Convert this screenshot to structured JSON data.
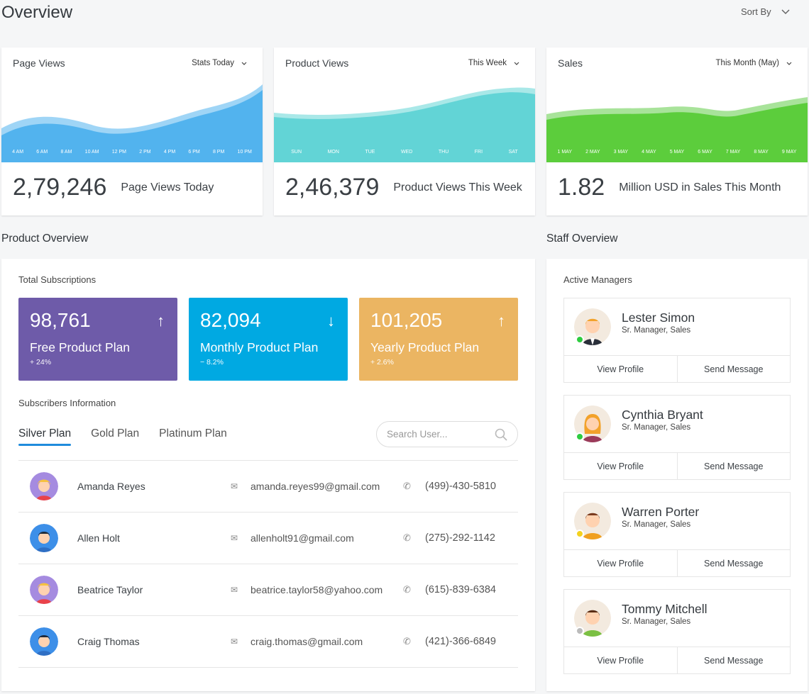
{
  "header": {
    "title": "Overview",
    "sort_label": "Sort By"
  },
  "stats": [
    {
      "title": "Page Views",
      "range": "Stats Today",
      "value": "2,79,246",
      "desc": "Page Views Today",
      "color": "#52b3ee",
      "ticks": [
        "4 AM",
        "6 AM",
        "8 AM",
        "10 AM",
        "12 PM",
        "2 PM",
        "4 PM",
        "6 PM",
        "8 PM",
        "10 PM"
      ]
    },
    {
      "title": "Product Views",
      "range": "This Week",
      "value": "2,46,379",
      "desc": "Product Views This Week",
      "color": "#62d4d6",
      "ticks": [
        "SUN",
        "MON",
        "TUE",
        "WED",
        "THU",
        "FRI",
        "SAT"
      ]
    },
    {
      "title": "Sales",
      "range": "This Month (May)",
      "value": "1.82",
      "desc": "Million USD in Sales This Month",
      "color": "#5ccd3c",
      "ticks": [
        "1 MAY",
        "2 MAY",
        "3 MAY",
        "4 MAY",
        "5 MAY",
        "6 MAY",
        "7 MAY",
        "8 MAY",
        "9 MAY"
      ]
    }
  ],
  "product": {
    "section_title": "Product Overview",
    "subscriptions_label": "Total Subscriptions",
    "plans": [
      {
        "value": "98,761",
        "name": "Free Product Plan",
        "pct": "+ 24%",
        "arrow": "↑",
        "color": "#6e5ba9"
      },
      {
        "value": "82,094",
        "name": "Monthly Product Plan",
        "pct": "− 8.2%",
        "arrow": "↓",
        "color": "#00a9e2"
      },
      {
        "value": "101,205",
        "name": "Yearly Product Plan",
        "pct": "+ 2.6%",
        "arrow": "↑",
        "color": "#ebb562"
      }
    ],
    "subscribers_label": "Subscribers Information",
    "tabs": [
      "Silver Plan",
      "Gold Plan",
      "Platinum Plan"
    ],
    "search_placeholder": "Search User...",
    "rows": [
      {
        "name": "Amanda Reyes",
        "email": "amanda.reyes99@gmail.com",
        "phone": "(499)-430-5810"
      },
      {
        "name": "Allen Holt",
        "email": "allenholt91@gmail.com",
        "phone": "(275)-292-1142"
      },
      {
        "name": "Beatrice Taylor",
        "email": "beatrice.taylor58@yahoo.com",
        "phone": "(615)-839-6384"
      },
      {
        "name": "Craig Thomas",
        "email": "craig.thomas@gmail.com",
        "phone": "(421)-366-6849"
      }
    ]
  },
  "staff": {
    "section_title": "Staff Overview",
    "managers_label": "Active Managers",
    "view_label": "View Profile",
    "message_label": "Send Message",
    "managers": [
      {
        "name": "Lester Simon",
        "role": "Sr. Manager, Sales",
        "status": "#2ecc40"
      },
      {
        "name": "Cynthia Bryant",
        "role": "Sr. Manager, Sales",
        "status": "#2ecc40"
      },
      {
        "name": "Warren Porter",
        "role": "Sr. Manager, Sales",
        "status": "#f4d21f"
      },
      {
        "name": "Tommy Mitchell",
        "role": "Sr. Manager, Sales",
        "status": "#bbbbbb"
      }
    ]
  }
}
